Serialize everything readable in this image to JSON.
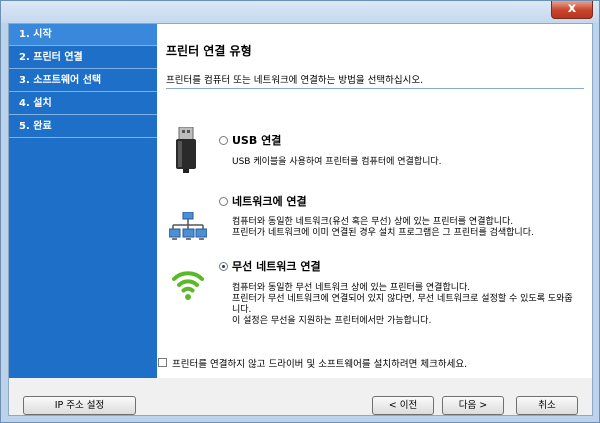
{
  "window": {
    "close_label": "x"
  },
  "sidebar": {
    "steps": [
      {
        "label": "1. 시작"
      },
      {
        "label": "2. 프린터 연결"
      },
      {
        "label": "3. 소프트웨어 선택"
      },
      {
        "label": "4. 설치"
      },
      {
        "label": "5. 완료"
      }
    ]
  },
  "main": {
    "title": "프린터 연결 유형",
    "description": "프린터를 컴퓨터 또는 네트워크에 연결하는 방법을 선택하십시오.",
    "options": [
      {
        "title": "USB 연결",
        "desc": "USB 케이블을 사용하여 프린터를 컴퓨터에 연결합니다.",
        "selected": false
      },
      {
        "title": "네트워크에 연결",
        "desc": "컴퓨터와 동일한 네트워크(유선 혹은 무선) 상에 있는 프린터를 연결합니다.\n프린터가 네트워크에 이미 연결된 경우 설치 프로그램은 그 프린터를 검색합니다.",
        "selected": false
      },
      {
        "title": "무선 네트워크 연결",
        "desc": "컴퓨터와 동일한 무선 네트워크 상에 있는 프린터를 연결합니다.\n프린터가 무선 네트워크에 연결되어 있지 않다면, 무선 네트워크로 설정할 수 있도록 도와줍니다.\n이 설정은 무선을 지원하는 프린터에서만 가능합니다.",
        "selected": true
      }
    ],
    "skip_checkbox_label": "프린터를 연결하지 않고 드라이버 및 소프트웨어를 설치하려면 체크하세요."
  },
  "buttons": {
    "ip_settings": "IP 주소 설정",
    "back": "< 이전",
    "next": "다음 >",
    "cancel": "취소"
  },
  "colors": {
    "sidebar": "#1e6fc8",
    "wifi": "#5cb82a"
  }
}
